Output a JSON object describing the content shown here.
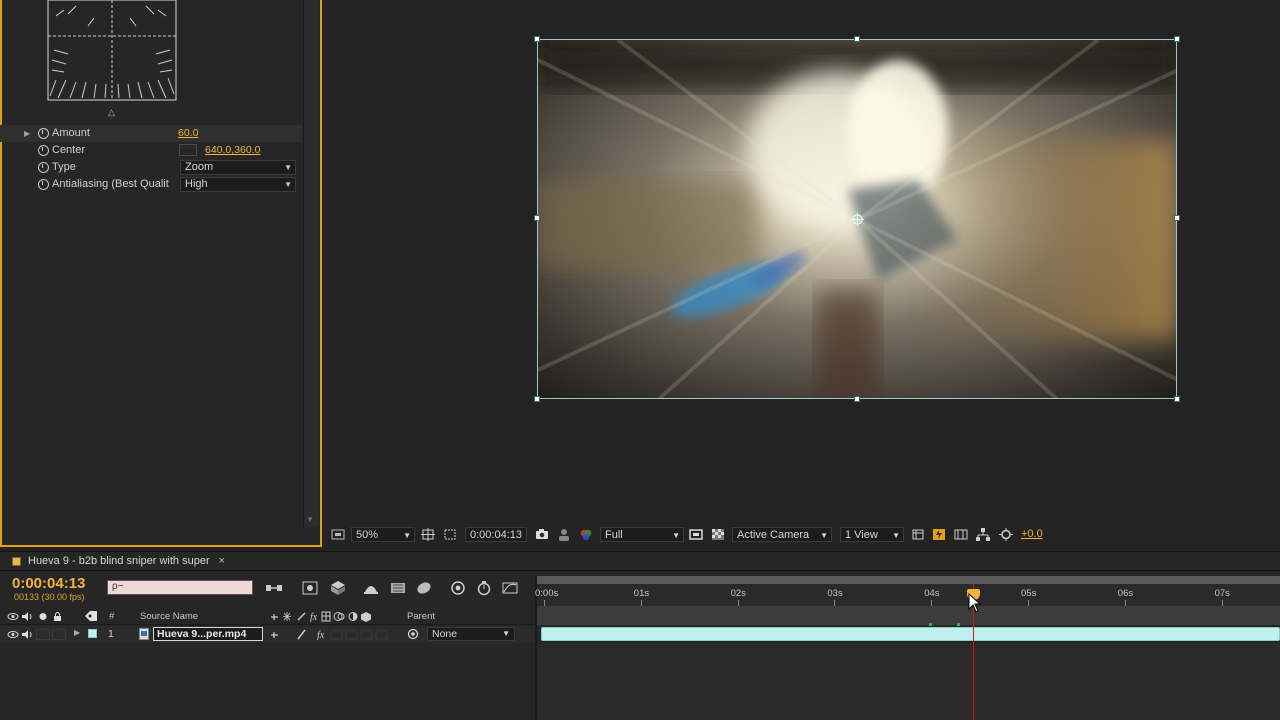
{
  "effect_controls": {
    "properties": [
      {
        "label": "Amount",
        "value": "60.0",
        "has_twirl": true
      },
      {
        "label": "Center",
        "value": "640.0,360.0"
      },
      {
        "label": "Type",
        "value": "Zoom"
      },
      {
        "label": "Antialiasing (Best Qualit",
        "value": "High"
      }
    ]
  },
  "viewer_toolbar": {
    "magnification": "50%",
    "timecode": "0:00:04:13",
    "resolution": "Full",
    "camera": "Active Camera",
    "views": "1 View",
    "exposure": "+0.0"
  },
  "timeline": {
    "tab_title": "Hueva 9 - b2b blind sniper with super",
    "close_glyph": "×",
    "current_time": "0:00:04:13",
    "frame_info": "00133 (30.00 fps)",
    "search_placeholder": "ρ−",
    "columns": {
      "number": "#",
      "source_name": "Source Name",
      "parent": "Parent"
    },
    "layer": {
      "index": "1",
      "name": "Hueva 9...per.mp4",
      "parent": "None"
    },
    "ruler_labels": [
      "0:00s",
      "01s",
      "02s",
      "03s",
      "04s",
      "05s",
      "06s",
      "07s"
    ],
    "playhead_seconds": 4.43
  },
  "colors": {
    "accent_orange": "#f0b43c",
    "playhead_red": "#e01010",
    "layer_bar_cyan": "#bff0f0",
    "panel_highlight_border": "#e0a017"
  }
}
